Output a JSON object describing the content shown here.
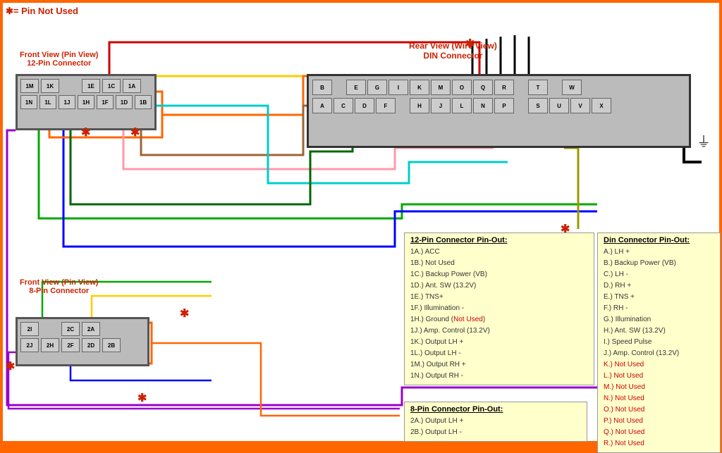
{
  "legend": {
    "symbol": "✱= Pin Not Used"
  },
  "front12pin": {
    "label_line1": "Front View (Pin View)",
    "label_line2": "12-Pin Connector",
    "row1": [
      "1M",
      "1K",
      "",
      "1E",
      "1C",
      "1A"
    ],
    "row2": [
      "1N",
      "1L",
      "1J",
      "1H",
      "1F",
      "1D",
      "1B"
    ]
  },
  "front8pin": {
    "label_line1": "Front View (Pin View)",
    "label_line2": "8-Pin Connector",
    "row1": [
      "2I",
      "",
      "2C",
      "2A"
    ],
    "row2": [
      "2J",
      "2H",
      "2F",
      "2D",
      "2B"
    ]
  },
  "din_connector": {
    "label_line1": "Rear View (Wire View)",
    "label_line2": "DIN Connector",
    "top_row": [
      "B",
      "",
      "E",
      "G",
      "I",
      "K",
      "M",
      "O",
      "Q",
      "R",
      "",
      "T",
      "",
      "W"
    ],
    "bot_row": [
      "A",
      "C",
      "D",
      "F",
      "",
      "H",
      "J",
      "L",
      "N",
      "P",
      "",
      "S",
      "U",
      "V",
      "X"
    ]
  },
  "info_12pin": {
    "title": "12-Pin Connector Pin-Out:",
    "entries": [
      "1A.)  ACC",
      "1B.)  Not Used",
      "1C.)  Backup Power (VB)",
      "1D.)  Ant. SW (13.2V)",
      "1E.)  TNS+",
      "1F.)  Illumination -",
      "1H.)  Ground (Not Used)",
      "1J.)  Amp. Control (13.2V)",
      "1K.)  Output LH +",
      "1L.)  Output LH -",
      "1M.)  Output RH +",
      "1N.)  Output RH -"
    ]
  },
  "info_8pin": {
    "title": "8-Pin Connector Pin-Out:",
    "entries": [
      "2A.)  Output LH +",
      "2B.)  Output LH -"
    ]
  },
  "info_din": {
    "title": "Din Connector Pin-Out:",
    "entries": [
      "A.)  LH +",
      "B.)  Backup Power (VB)",
      "C.)  LH -",
      "D.)  RH +",
      "E.)  TNS +",
      "F.)  RH -",
      "G.)  Illumination",
      "H.)  Ant. SW (13.2V)",
      "I.)   Speed Pulse",
      "J.)  Amp. Control (13.2V)",
      "K.)  Not Used",
      "L.)  Not Used",
      "M.)  Not Used",
      "N.)  Not Used",
      "O.)  Not Used",
      "P.)  Not Used",
      "Q.)  Not Used",
      "R.)  Not Used"
    ]
  }
}
